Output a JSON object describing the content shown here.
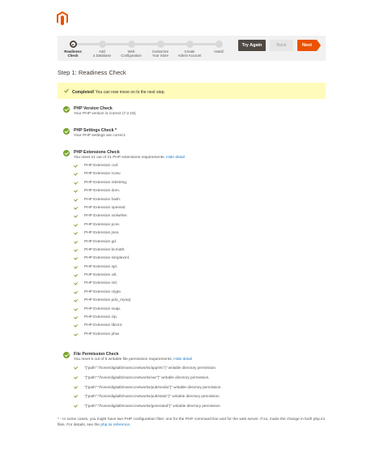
{
  "brand": {
    "logo": "magento-logo",
    "color": "#eb5202"
  },
  "wizard": {
    "steps": [
      {
        "label": "Readiness\nCheck",
        "state": "active"
      },
      {
        "label": "Add\na Database",
        "state": "pending"
      },
      {
        "label": "Web\nConfiguration",
        "state": "pending"
      },
      {
        "label": "Customize\nYour Store",
        "state": "pending"
      },
      {
        "label": "Create\nAdmin Account",
        "state": "pending"
      },
      {
        "label": "Install",
        "state": "pending"
      }
    ],
    "try_again_label": "Try Again",
    "back_label": "Back",
    "next_label": "Next"
  },
  "step_title": "Step 1: Readiness Check",
  "message": {
    "strong": "Completed!",
    "text": " You can now move on to the next step."
  },
  "checks": {
    "php_version": {
      "title": "PHP Version Check",
      "sub": "Your PHP version is correct (7.2.19)."
    },
    "php_settings": {
      "title": "PHP Settings Check *",
      "sub": "Your PHP settings are correct."
    },
    "php_extensions": {
      "title": "PHP Extensions Check",
      "sub": "You meet 21 out of 21 PHP extensions requirements.",
      "link": "Hide detail",
      "items": [
        "PHP Extension curl.",
        "PHP Extension iconv.",
        "PHP Extension mbstring.",
        "PHP Extension dom.",
        "PHP Extension hash.",
        "PHP Extension openssl.",
        "PHP Extension xmlwriter.",
        "PHP Extension pcre.",
        "PHP Extension json.",
        "PHP Extension gd.",
        "PHP Extension bcmath.",
        "PHP Extension simplexml.",
        "PHP Extension spl.",
        "PHP Extension xsl.",
        "PHP Extension intl.",
        "PHP Extension ctype.",
        "PHP Extension pdo_mysql.",
        "PHP Extension soap.",
        "PHP Extension zip.",
        "PHP Extension libxml.",
        "PHP Extension phar."
      ]
    },
    "file_permission": {
      "title": "File Permission Check",
      "sub": "You meet 5 out of 5 writable file permission requirements.",
      "link": "Hide detail",
      "items": [
        "\"{\"path\":\"/home/digitalb/marsccnetworks/app/etc\"}\" writable directory permission.",
        "\"{\"path\":\"/home/digitalb/marsccnetworks/var\"}\" writable directory permission.",
        "\"{\"path\":\"/home/digitalb/marsccnetworks/pub/media\"}\" writable directory permission.",
        "\"{\"path\":\"/home/digitalb/marsccnetworks/pub/static\"}\" writable directory permission.",
        "\"{\"path\":\"/home/digitalb/marsccnetworks/generated\"}\" writable directory permission."
      ]
    }
  },
  "footnote": {
    "text": "* - In some cases, you might have two PHP configuration files: one for the PHP command line and for the web server. If so, make the change in both php.ini files. For details, see the ",
    "link": "php.ini reference",
    "end": "."
  },
  "colors": {
    "success": "#79a22e",
    "notice_bg": "#fffbbb",
    "link": "#1979c3",
    "dark_button": "#514943"
  }
}
